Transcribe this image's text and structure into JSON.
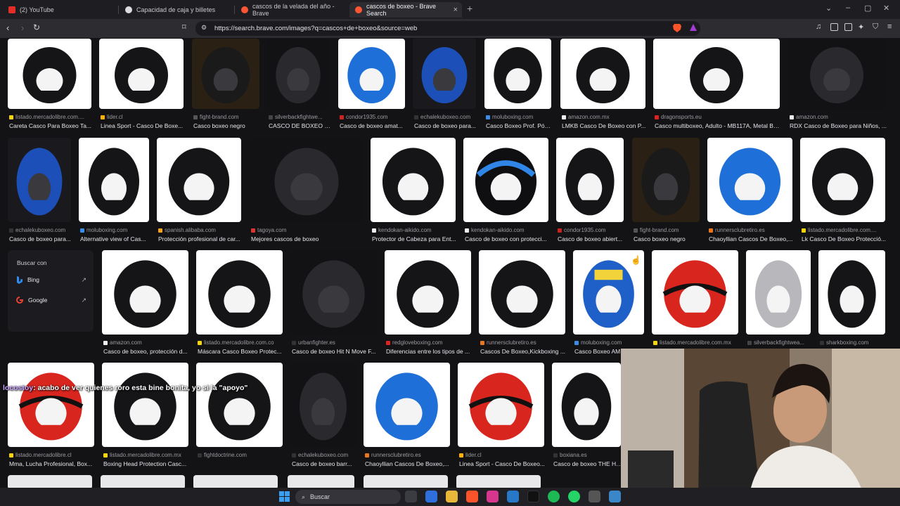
{
  "browser": {
    "tabs": [
      {
        "label": "(2) YouTube",
        "color": "#e52d27"
      },
      {
        "label": "Capacidad de caja y billetes",
        "color": "#dcdce0"
      },
      {
        "label": "cascos de la velada del año - Brave",
        "color": "#ff5534"
      },
      {
        "label": "cascos de boxeo - Brave Search",
        "color": "#ff5534"
      }
    ],
    "tab_close": "×",
    "new_tab": "+",
    "url": "https://search.brave.com/images?q=cascos+de+boxeo&source=web"
  },
  "results": [
    {
      "src": "listado.mercadolibre.com....",
      "title": "Careta Casco Para Boxeo Ta...",
      "icon": "#f5d40a"
    },
    {
      "src": "lider.cl",
      "title": "Linea Sport - Casco De Boxe...",
      "icon": "#ffb100"
    },
    {
      "src": "fight-brand.com",
      "title": "Casco boxeo negro",
      "icon": "#555"
    },
    {
      "src": "silverbackfightwe...",
      "title": "CASCO DE BOXEO - ...",
      "icon": "#444"
    },
    {
      "src": "condor1935.com",
      "title": "Casco de boxeo amat...",
      "icon": "#c22"
    },
    {
      "src": "echalekuboxeo.com",
      "title": "Casco de boxeo para...",
      "icon": "#333"
    },
    {
      "src": "moluboxing.com",
      "title": "Casco Boxeo Prof. Póm...",
      "icon": "#3a8ee6"
    },
    {
      "src": "amazon.com.mx",
      "title": "LMKB Casco De Boxeo con P...",
      "icon": "#eee"
    },
    {
      "src": "dragonsports.eu",
      "title": "Casco multiboxeo, Adulto - MB117A, Metal Bo...",
      "icon": "#d22"
    },
    {
      "src": "amazon.com",
      "title": "RDX Casco de Boxeo para Niños, ...",
      "icon": "#eee"
    },
    {
      "src": "echalekuboxeo.com",
      "title": "Casco de boxeo para...",
      "icon": "#333"
    },
    {
      "src": "moluboxing.com",
      "title": "Alternative view of Cas...",
      "icon": "#3a8ee6"
    },
    {
      "src": "spanish.alibaba.com",
      "title": "Protección profesional de car...",
      "icon": "#f7a21b"
    },
    {
      "src": "tagoya.com",
      "title": "Mejores cascos de boxeo",
      "icon": "#d33"
    },
    {
      "src": "kendokan-aikido.com",
      "title": "Protector de Cabeza para Ent...",
      "icon": "#eee"
    },
    {
      "src": "kendokan-aikido.com",
      "title": "Casco de boxeo con protecci...",
      "icon": "#eee"
    },
    {
      "src": "condor1935.com",
      "title": "Casco de boxeo abiert...",
      "icon": "#c22"
    },
    {
      "src": "fight-brand.com",
      "title": "Casco boxeo negro",
      "icon": "#555"
    },
    {
      "src": "runnersclubretiro.es",
      "title": "Chaoyllian Cascos De Boxeo,...",
      "icon": "#e87722"
    },
    {
      "src": "listado.mercadolibre.com....",
      "title": "Lk Casco De Boxeo Protecció...",
      "icon": "#f5d40a"
    },
    {
      "src": "amazon.com",
      "title": "Casco de boxeo, protección d...",
      "icon": "#eee"
    },
    {
      "src": "listado.mercadolibre.com.co",
      "title": "Máscara Casco Boxeo Protec...",
      "icon": "#f5d40a"
    },
    {
      "src": "urbanfighter.es",
      "title": "Casco de boxeo Hit N Move F...",
      "icon": "#333"
    },
    {
      "src": "redgloveboxing.com",
      "title": "Diferencias entre los tipos de ...",
      "icon": "#d22"
    },
    {
      "src": "runnersclubretiro.es",
      "title": "Cascos De Boxeo,Kickboxing ...",
      "icon": "#e87722"
    },
    {
      "src": "moluboxing.com",
      "title": "Casco Boxeo AM...",
      "icon": "#3a8ee6"
    },
    {
      "src": "listado.mercadolibre.com.mx",
      "title": "",
      "icon": "#f5d40a"
    },
    {
      "src": "silverbackfightwea...",
      "title": "",
      "icon": "#444"
    },
    {
      "src": "sharkboxing.com",
      "title": "",
      "icon": "#333"
    },
    {
      "src": "listado.mercadolibre.cl",
      "title": "Mma, Lucha Profesional, Box...",
      "icon": "#f5d40a"
    },
    {
      "src": "listado.mercadolibre.com.mx",
      "title": "Boxing Head Protection Casc...",
      "icon": "#f5d40a"
    },
    {
      "src": "fightdoctrine.com",
      "title": "",
      "icon": "#333"
    },
    {
      "src": "echalekuboxeo.com",
      "title": "Casco de boxeo barr...",
      "icon": "#333"
    },
    {
      "src": "runnersclubretiro.es",
      "title": "Chaoyllian Cascos De Boxeo,...",
      "icon": "#e87722"
    },
    {
      "src": "lider.cl",
      "title": "Linea Sport - Casco De Boxeo...",
      "icon": "#ffb100"
    },
    {
      "src": "boxiana.es",
      "title": "Casco de boxeo THE HE...",
      "icon": "#333"
    }
  ],
  "panel": {
    "title": "Buscar con",
    "engines": [
      "Bing",
      "Google"
    ]
  },
  "chat": {
    "user": "locostoy",
    "message": ": acabo de ver quienes roro esta bine bonita, yo si la \"apoyo\""
  },
  "taskbar": {
    "search_placeholder": "Buscar"
  }
}
